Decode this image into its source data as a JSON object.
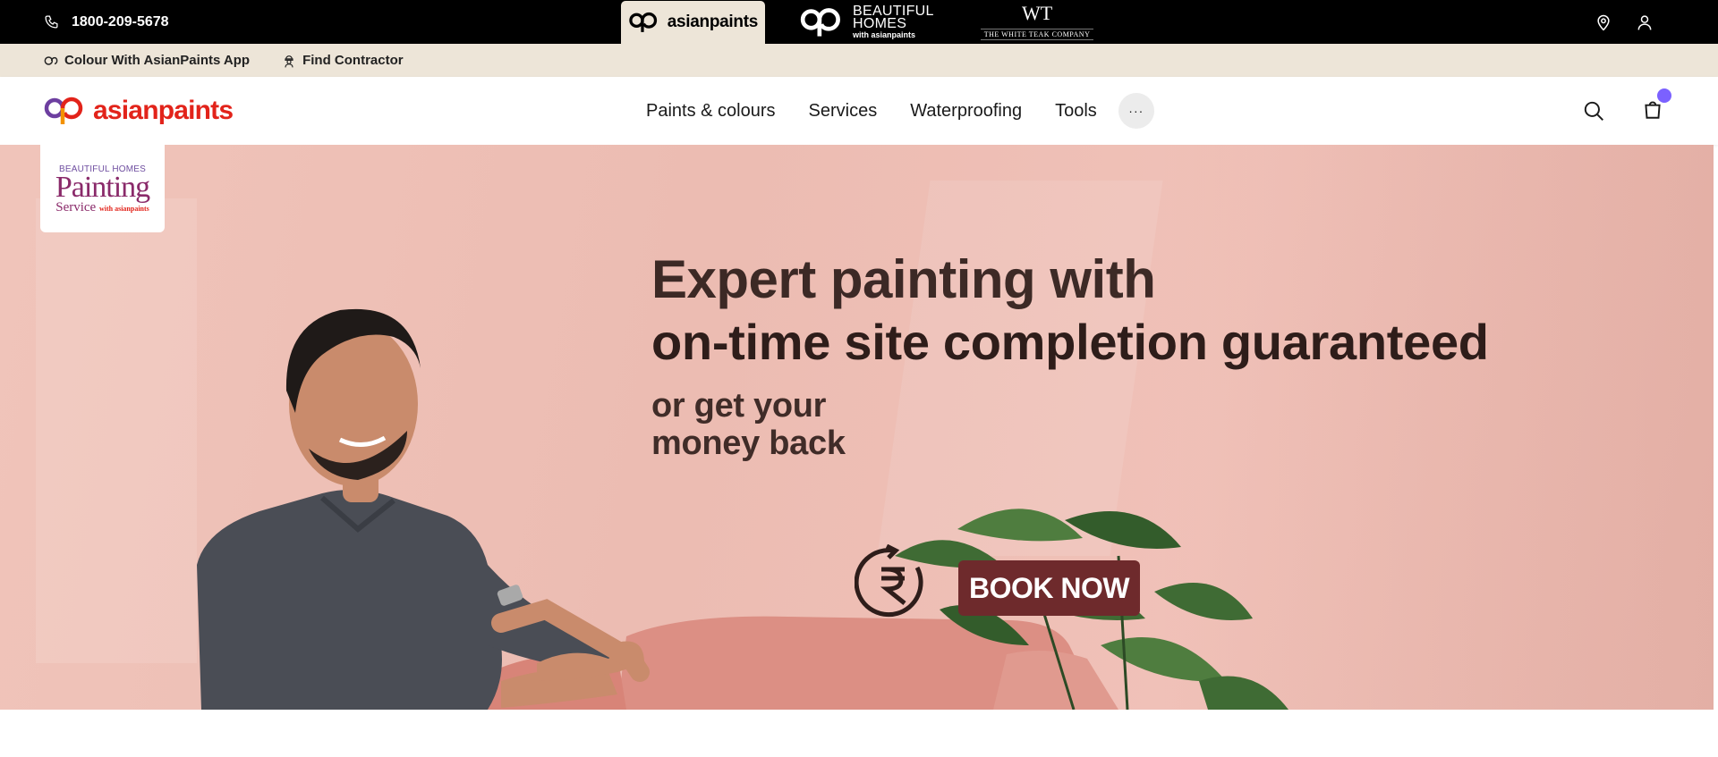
{
  "topbar": {
    "phone": "1800-209-5678",
    "brands": [
      {
        "label": "asianpaints",
        "active": true
      },
      {
        "label": "BEAUTIFUL",
        "line2": "HOMES",
        "tagline": "with asianpaints"
      },
      {
        "label": "WT",
        "name": "THE WHITE TEAK COMPANY"
      }
    ],
    "icons": [
      "location-pin-icon",
      "user-icon"
    ]
  },
  "utilbar": {
    "items": [
      {
        "label": "Colour With AsianPaints App",
        "icon": "app-icon"
      },
      {
        "label": "Find Contractor",
        "icon": "contractor-icon"
      }
    ]
  },
  "nav": {
    "logo": "asianpaints",
    "menu": [
      {
        "label": "Paints & colours"
      },
      {
        "label": "Services"
      },
      {
        "label": "Waterproofing"
      },
      {
        "label": "Tools"
      }
    ],
    "more_label": "···",
    "icons": [
      "search-icon",
      "cart-icon"
    ]
  },
  "hero": {
    "badge": {
      "brand": "BEAUTIFUL HOMES",
      "title": "Painting",
      "subtitle": "Service",
      "tagline": "with asianpaints"
    },
    "line1": "Expert painting with",
    "line2": "on-time site completion guaranteed",
    "line3a": "or get your",
    "line3b": "money back",
    "cta": "BOOK NOW"
  },
  "colors": {
    "topbar_bg": "#000000",
    "utilbar_bg": "#ede5d8",
    "brand_red": "#e2231a",
    "cta_bg": "#6e2a2c",
    "hero_bg": "#ecbcb2",
    "cart_dot": "#7b61ff"
  }
}
